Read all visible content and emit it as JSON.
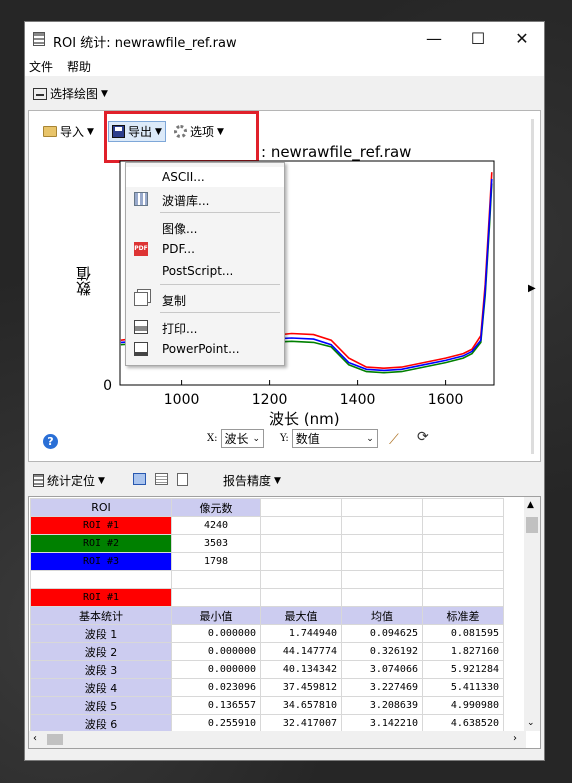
{
  "window": {
    "title": "ROI 统计: newrawfile_ref.raw",
    "controls": {
      "minimize": "—",
      "maximize": "☐",
      "close": "✕"
    }
  },
  "menubar": {
    "items": [
      "文件",
      "帮助"
    ]
  },
  "toolbar": {
    "select_plot": "选择绘图"
  },
  "plot_toolbar": {
    "import": "导入",
    "export": "导出",
    "options": "选项"
  },
  "export_menu": {
    "items": [
      "ASCII...",
      "波谱库...",
      "图像...",
      "PDF...",
      "PostScript...",
      "复制",
      "打印...",
      "PowerPoint..."
    ]
  },
  "plot": {
    "title_visible": ": newrawfile_ref.raw",
    "ylabel": "数值",
    "xlabel": "波长 (nm)",
    "x_selector_label": "X:",
    "x_selector_value": "波长",
    "y_selector_label": "Y:",
    "y_selector_value": "数值"
  },
  "chart_data": {
    "type": "line",
    "xlabel": "波长 (nm)",
    "ylabel": "数值",
    "xlim": [
      860,
      1710
    ],
    "ylim": [
      0,
      100
    ],
    "xticks": [
      1000,
      1200,
      1400,
      1600
    ],
    "yticks": [
      0
    ],
    "grid": false,
    "series": [
      {
        "name": "ROI #1",
        "color": "#ff0000",
        "x": [
          862,
          900,
          1000,
          1100,
          1200,
          1250,
          1300,
          1340,
          1380,
          1420,
          1460,
          1500,
          1550,
          1600,
          1640,
          1660,
          1680,
          1690,
          1700,
          1705
        ],
        "y": [
          20,
          21,
          21,
          21,
          22,
          23,
          22.5,
          20,
          12,
          8,
          7.5,
          8,
          10,
          12,
          14,
          16,
          22,
          45,
          78,
          95
        ]
      },
      {
        "name": "ROI #2",
        "color": "#008000",
        "x": [
          862,
          900,
          1000,
          1100,
          1200,
          1250,
          1300,
          1340,
          1380,
          1420,
          1460,
          1500,
          1550,
          1600,
          1640,
          1660,
          1680,
          1690,
          1700,
          1705
        ],
        "y": [
          18,
          18.5,
          18.5,
          18.5,
          19,
          19.5,
          19,
          17,
          9,
          6,
          5.5,
          6,
          8,
          10,
          12,
          14,
          19,
          40,
          72,
          90
        ]
      },
      {
        "name": "ROI #3",
        "color": "#0000ff",
        "x": [
          862,
          900,
          1000,
          1100,
          1200,
          1250,
          1300,
          1340,
          1380,
          1420,
          1460,
          1500,
          1550,
          1600,
          1640,
          1660,
          1680,
          1690,
          1700,
          1705
        ],
        "y": [
          19,
          19.5,
          19.5,
          19.5,
          20.5,
          21,
          20.5,
          18,
          10,
          7,
          6.5,
          7,
          9,
          11,
          13,
          15,
          20,
          42,
          75,
          92
        ]
      }
    ]
  },
  "bottom_toolbar": {
    "stat_locate": "统计定位",
    "report_precision": "报告精度"
  },
  "table": {
    "roi_header": [
      "ROI",
      "像元数"
    ],
    "rois": [
      {
        "name": "ROI #1",
        "color": "#ff0000",
        "pixels": "4240"
      },
      {
        "name": "ROI #2",
        "color": "#008000",
        "pixels": "3503"
      },
      {
        "name": "ROI #3",
        "color": "#0000ff",
        "pixels": "1798"
      }
    ],
    "selected_roi": "ROI #1",
    "stats_header": [
      "基本统计",
      "最小值",
      "最大值",
      "均值",
      "标准差"
    ],
    "stats_rows": [
      [
        "波段 1",
        "0.000000",
        "1.744940",
        "0.094625",
        "0.081595"
      ],
      [
        "波段 2",
        "0.000000",
        "44.147774",
        "0.326192",
        "1.827160"
      ],
      [
        "波段 3",
        "0.000000",
        "40.134342",
        "3.074066",
        "5.921284"
      ],
      [
        "波段 4",
        "0.023096",
        "37.459812",
        "3.227469",
        "5.411330"
      ],
      [
        "波段 5",
        "0.136557",
        "34.657810",
        "3.208639",
        "4.990980"
      ],
      [
        "波段 6",
        "0.255910",
        "32.417007",
        "3.142210",
        "4.638520"
      ]
    ]
  }
}
